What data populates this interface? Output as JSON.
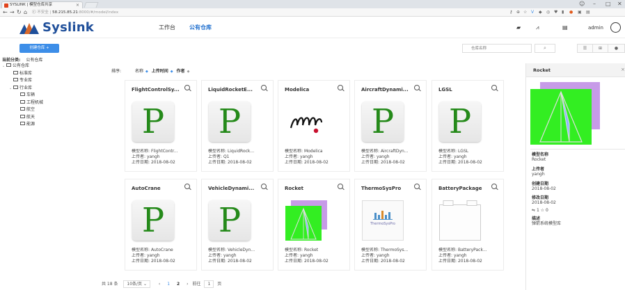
{
  "browser": {
    "tab_title": "SYSLINK | 模型仓库共享",
    "url_prefix": "不安全",
    "url_host": "58.215.85.21",
    "url_path": ":8000/#/model/index",
    "win_min": "–",
    "win_max": "□",
    "win_close": "✕"
  },
  "header": {
    "logo_text": "Syslink",
    "nav": [
      "工作台",
      "公有仓库"
    ],
    "username": "admin"
  },
  "toolbar": {
    "create_label": "创建仓库 +",
    "search_placeholder": "仓库名称",
    "search_icon": "search-icon",
    "view_options": [
      "list-icon",
      "grid-icon",
      "info-icon"
    ]
  },
  "breadcrumb": {
    "label": "当前分类:",
    "value": "公有仓库"
  },
  "tree": [
    {
      "label": "公有仓库",
      "level": 0,
      "expanded": true
    },
    {
      "label": "标准库",
      "level": 1
    },
    {
      "label": "专业库",
      "level": 1
    },
    {
      "label": "行业库",
      "level": 1,
      "expanded": true
    },
    {
      "label": "车辆",
      "level": 2
    },
    {
      "label": "工程机械",
      "level": 2
    },
    {
      "label": "航空",
      "level": 2
    },
    {
      "label": "航天",
      "level": 2
    },
    {
      "label": "能源",
      "level": 2
    }
  ],
  "sort": {
    "label": "排序:",
    "options": [
      "名称",
      "上传时间",
      "作者"
    ]
  },
  "meta_labels": {
    "name": "模型名称:",
    "uploader": "上传者:",
    "date": "上传日期:"
  },
  "models": [
    {
      "title": "FlightControlSy...",
      "name": "FlightContr...",
      "uploader": "yangh",
      "date": "2018-08-02",
      "thumb": "P"
    },
    {
      "title": "LiquidRocketE...",
      "name": "LiquidRock...",
      "uploader": "Q1",
      "date": "2018-08-02",
      "thumb": "P"
    },
    {
      "title": "Modelica",
      "name": "Modelica",
      "uploader": "yangh",
      "date": "2018-08-02",
      "thumb": "modelica"
    },
    {
      "title": "AircraftDynami...",
      "name": "AircraftDyn...",
      "uploader": "yangh",
      "date": "2018-08-02",
      "thumb": "P"
    },
    {
      "title": "LGSL",
      "name": "LGSL",
      "uploader": "yangh",
      "date": "2018-08-02",
      "thumb": "P"
    },
    {
      "title": "AutoCrane",
      "name": "AutoCrane",
      "uploader": "yangh",
      "date": "2018-08-02",
      "thumb": "P"
    },
    {
      "title": "VehicleDynami...",
      "name": "VehicleDyn...",
      "uploader": "yangh",
      "date": "2018-08-02",
      "thumb": "P"
    },
    {
      "title": "Rocket",
      "name": "Rocket",
      "uploader": "yangh",
      "date": "2018-08-02",
      "thumb": "rocket"
    },
    {
      "title": "ThermoSysPro",
      "name": "ThermoSys...",
      "uploader": "yangh",
      "date": "2018-08-02",
      "thumb": "thermo"
    },
    {
      "title": "BatteryPackage",
      "name": "BatteryPack...",
      "uploader": "yangh",
      "date": "2018-08-02",
      "thumb": "battery"
    }
  ],
  "thumb_caption": {
    "thermo": "ThermoSysPro"
  },
  "pagination": {
    "total": "共 18 条",
    "per_page": "10条/页",
    "pages": [
      "1",
      "2"
    ],
    "current": "2",
    "goto_label": "前往",
    "goto_value": "1",
    "goto_suffix": "页"
  },
  "detail": {
    "title": "Rocket",
    "fields": [
      {
        "label": "模型名称",
        "value": "Rocket"
      },
      {
        "label": "上传者",
        "value": "yangh"
      },
      {
        "label": "创建日期",
        "value": "2018-08-02"
      },
      {
        "label": "修改日期",
        "value": "2018-08-02"
      }
    ],
    "stats": "1 ☆ 0",
    "desc_label": "描述",
    "desc_value": "弹箭系统模型库"
  },
  "colors": {
    "accent": "#3d8ee8",
    "logo": "#1f4f9a",
    "p_letter": "#258a1a",
    "rocket_bg": "#33ee22",
    "rocket_back": "#c79be8"
  }
}
